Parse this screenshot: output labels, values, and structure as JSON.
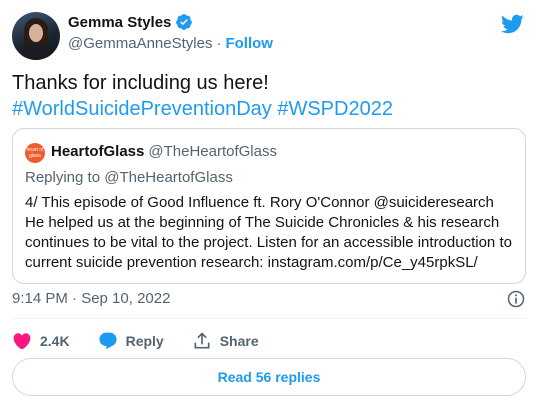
{
  "author": {
    "name": "Gemma Styles",
    "handle": "@GemmaAnneStyles",
    "separator": "·",
    "follow_label": "Follow"
  },
  "tweet": {
    "line1": "Thanks for including us here!",
    "hashtag1": "#WorldSuicidePreventionDay",
    "hashtag2": "#WSPD2022"
  },
  "quote": {
    "avatar_text": "heart of glass",
    "name": "HeartofGlass",
    "handle": "@TheHeartofGlass",
    "replying_to": "Replying to @TheHeartofGlass",
    "body": "4/ This episode of Good Influence ft. Rory O'Connor @suicideresearch He helped us at the beginning of The Suicide Chronicles & his research continues to be vital to the project. Listen for an accessible introduction to current suicide prevention research: instagram.com/p/Ce_y45rpkSL/"
  },
  "meta": {
    "timestamp": "9:14 PM · Sep 10, 2022"
  },
  "actions": {
    "likes": "2.4K",
    "reply_label": "Reply",
    "share_label": "Share"
  },
  "footer": {
    "read_replies": "Read 56 replies"
  },
  "colors": {
    "accent": "#1d9bf0",
    "like": "#f91880",
    "text": "#0f1419",
    "secondary": "#536471"
  }
}
